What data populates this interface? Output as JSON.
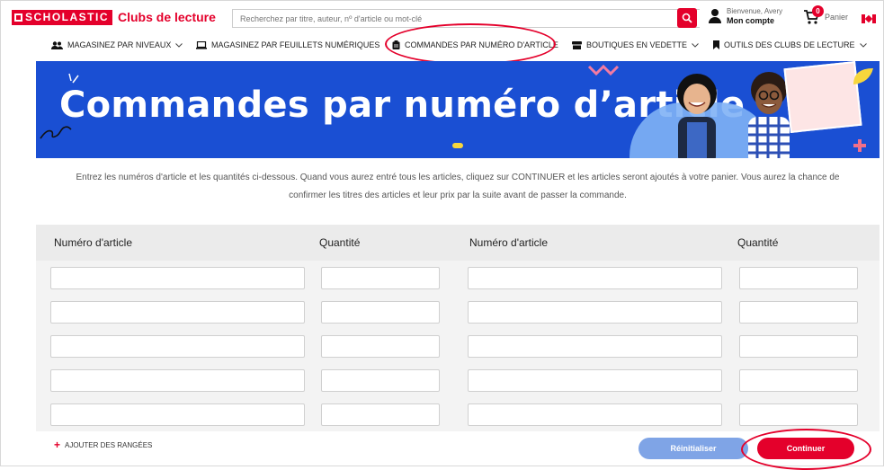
{
  "header": {
    "logo_mark": "SCHOLASTIC",
    "logo_text": "Clubs de lecture",
    "search_placeholder": "Recherchez par titre, auteur, nº d'article ou mot-clé",
    "greeting": "Bienvenue, Avery",
    "account_label": "Mon compte",
    "cart_count": "0",
    "cart_label": "Panier"
  },
  "nav": {
    "items": [
      {
        "label": "MAGASINEZ PAR NIVEAUX",
        "icon": "people-icon"
      },
      {
        "label": "MAGASINEZ PAR FEUILLETS NUMÉRIQUES",
        "icon": "laptop-icon"
      },
      {
        "label": "COMMANDES PAR NUMÉRO D'ARTICLE",
        "icon": "clipboard-icon"
      },
      {
        "label": "BOUTIQUES EN VEDETTE",
        "icon": "store-icon"
      },
      {
        "label": "OUTILS DES CLUBS DE LECTURE",
        "icon": "bookmark-icon"
      }
    ]
  },
  "banner": {
    "title": "Commandes par numéro d’article"
  },
  "intro": {
    "line1": "Entrez les numéros d'article et les quantités ci-dessous. Quand vous aurez entré tous les articles, cliquez sur CONTINUER et les articles seront ajoutés à votre panier. Vous aurez la chance de",
    "line2": "confirmer les titres des articles et leur prix par la suite avant de passer la commande."
  },
  "table": {
    "col_item": "Numéro d'article",
    "col_qty": "Quantité",
    "col_item2": "Numéro d'article",
    "col_qty2": "Quantité"
  },
  "actions": {
    "add_rows": "AJOUTER DES RANGÉES",
    "reset": "Réinitialiser",
    "continue": "Continuer"
  },
  "colors": {
    "brand_red": "#e4002b",
    "banner_blue": "#1a4fd3",
    "reset_blue": "#7fa4e6"
  }
}
